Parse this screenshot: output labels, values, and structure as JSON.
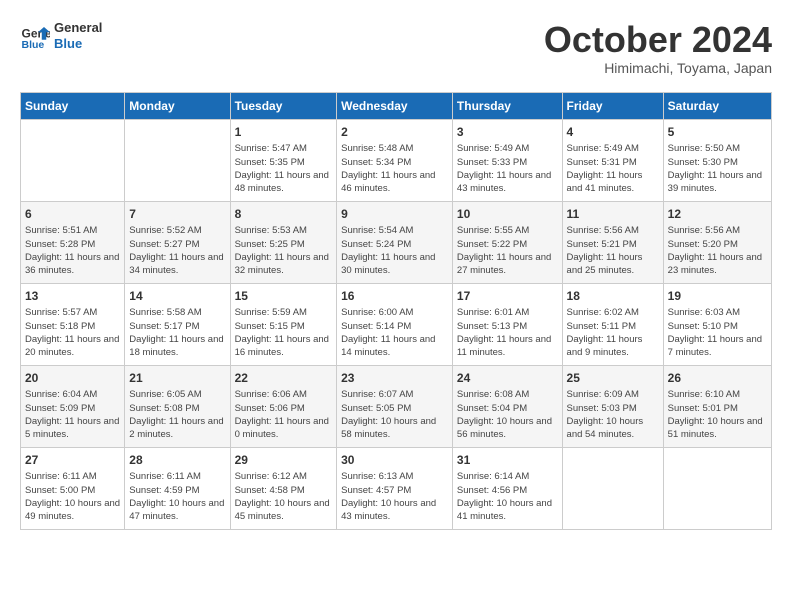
{
  "header": {
    "logo_line1": "General",
    "logo_line2": "Blue",
    "month_title": "October 2024",
    "subtitle": "Himimachi, Toyama, Japan"
  },
  "days_of_week": [
    "Sunday",
    "Monday",
    "Tuesday",
    "Wednesday",
    "Thursday",
    "Friday",
    "Saturday"
  ],
  "weeks": [
    [
      {
        "day": "",
        "info": ""
      },
      {
        "day": "",
        "info": ""
      },
      {
        "day": "1",
        "info": "Sunrise: 5:47 AM\nSunset: 5:35 PM\nDaylight: 11 hours and 48 minutes."
      },
      {
        "day": "2",
        "info": "Sunrise: 5:48 AM\nSunset: 5:34 PM\nDaylight: 11 hours and 46 minutes."
      },
      {
        "day": "3",
        "info": "Sunrise: 5:49 AM\nSunset: 5:33 PM\nDaylight: 11 hours and 43 minutes."
      },
      {
        "day": "4",
        "info": "Sunrise: 5:49 AM\nSunset: 5:31 PM\nDaylight: 11 hours and 41 minutes."
      },
      {
        "day": "5",
        "info": "Sunrise: 5:50 AM\nSunset: 5:30 PM\nDaylight: 11 hours and 39 minutes."
      }
    ],
    [
      {
        "day": "6",
        "info": "Sunrise: 5:51 AM\nSunset: 5:28 PM\nDaylight: 11 hours and 36 minutes."
      },
      {
        "day": "7",
        "info": "Sunrise: 5:52 AM\nSunset: 5:27 PM\nDaylight: 11 hours and 34 minutes."
      },
      {
        "day": "8",
        "info": "Sunrise: 5:53 AM\nSunset: 5:25 PM\nDaylight: 11 hours and 32 minutes."
      },
      {
        "day": "9",
        "info": "Sunrise: 5:54 AM\nSunset: 5:24 PM\nDaylight: 11 hours and 30 minutes."
      },
      {
        "day": "10",
        "info": "Sunrise: 5:55 AM\nSunset: 5:22 PM\nDaylight: 11 hours and 27 minutes."
      },
      {
        "day": "11",
        "info": "Sunrise: 5:56 AM\nSunset: 5:21 PM\nDaylight: 11 hours and 25 minutes."
      },
      {
        "day": "12",
        "info": "Sunrise: 5:56 AM\nSunset: 5:20 PM\nDaylight: 11 hours and 23 minutes."
      }
    ],
    [
      {
        "day": "13",
        "info": "Sunrise: 5:57 AM\nSunset: 5:18 PM\nDaylight: 11 hours and 20 minutes."
      },
      {
        "day": "14",
        "info": "Sunrise: 5:58 AM\nSunset: 5:17 PM\nDaylight: 11 hours and 18 minutes."
      },
      {
        "day": "15",
        "info": "Sunrise: 5:59 AM\nSunset: 5:15 PM\nDaylight: 11 hours and 16 minutes."
      },
      {
        "day": "16",
        "info": "Sunrise: 6:00 AM\nSunset: 5:14 PM\nDaylight: 11 hours and 14 minutes."
      },
      {
        "day": "17",
        "info": "Sunrise: 6:01 AM\nSunset: 5:13 PM\nDaylight: 11 hours and 11 minutes."
      },
      {
        "day": "18",
        "info": "Sunrise: 6:02 AM\nSunset: 5:11 PM\nDaylight: 11 hours and 9 minutes."
      },
      {
        "day": "19",
        "info": "Sunrise: 6:03 AM\nSunset: 5:10 PM\nDaylight: 11 hours and 7 minutes."
      }
    ],
    [
      {
        "day": "20",
        "info": "Sunrise: 6:04 AM\nSunset: 5:09 PM\nDaylight: 11 hours and 5 minutes."
      },
      {
        "day": "21",
        "info": "Sunrise: 6:05 AM\nSunset: 5:08 PM\nDaylight: 11 hours and 2 minutes."
      },
      {
        "day": "22",
        "info": "Sunrise: 6:06 AM\nSunset: 5:06 PM\nDaylight: 11 hours and 0 minutes."
      },
      {
        "day": "23",
        "info": "Sunrise: 6:07 AM\nSunset: 5:05 PM\nDaylight: 10 hours and 58 minutes."
      },
      {
        "day": "24",
        "info": "Sunrise: 6:08 AM\nSunset: 5:04 PM\nDaylight: 10 hours and 56 minutes."
      },
      {
        "day": "25",
        "info": "Sunrise: 6:09 AM\nSunset: 5:03 PM\nDaylight: 10 hours and 54 minutes."
      },
      {
        "day": "26",
        "info": "Sunrise: 6:10 AM\nSunset: 5:01 PM\nDaylight: 10 hours and 51 minutes."
      }
    ],
    [
      {
        "day": "27",
        "info": "Sunrise: 6:11 AM\nSunset: 5:00 PM\nDaylight: 10 hours and 49 minutes."
      },
      {
        "day": "28",
        "info": "Sunrise: 6:11 AM\nSunset: 4:59 PM\nDaylight: 10 hours and 47 minutes."
      },
      {
        "day": "29",
        "info": "Sunrise: 6:12 AM\nSunset: 4:58 PM\nDaylight: 10 hours and 45 minutes."
      },
      {
        "day": "30",
        "info": "Sunrise: 6:13 AM\nSunset: 4:57 PM\nDaylight: 10 hours and 43 minutes."
      },
      {
        "day": "31",
        "info": "Sunrise: 6:14 AM\nSunset: 4:56 PM\nDaylight: 10 hours and 41 minutes."
      },
      {
        "day": "",
        "info": ""
      },
      {
        "day": "",
        "info": ""
      }
    ]
  ]
}
